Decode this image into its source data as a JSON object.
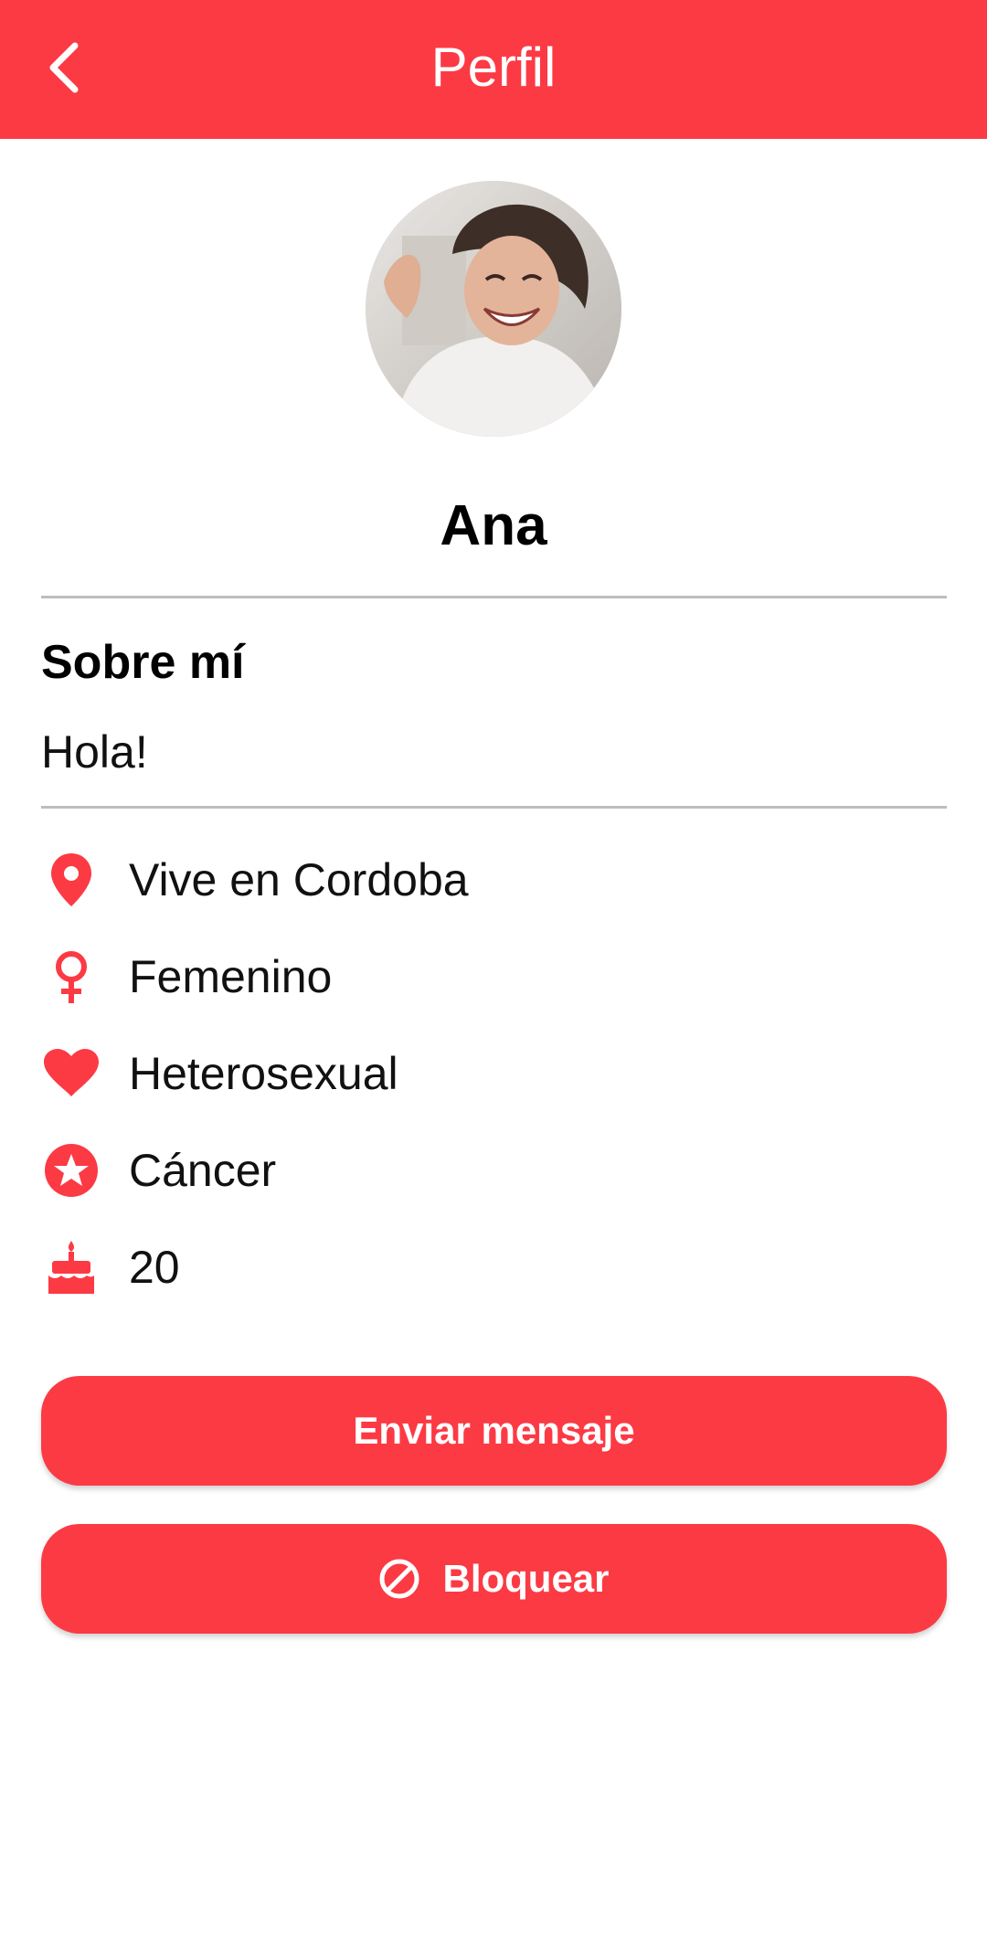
{
  "header": {
    "title": "Perfil",
    "back_icon": "chevron-left-icon",
    "background": "#fc3a44"
  },
  "profile": {
    "name": "Ana",
    "avatar_icon": "profile-photo"
  },
  "about": {
    "title": "Sobre mí",
    "text": "Hola!"
  },
  "details": [
    {
      "icon": "location-pin-icon",
      "text": "Vive en Cordoba"
    },
    {
      "icon": "female-symbol-icon",
      "text": "Femenino"
    },
    {
      "icon": "heart-icon",
      "text": "Heterosexual"
    },
    {
      "icon": "star-circle-icon",
      "text": "Cáncer"
    },
    {
      "icon": "birthday-cake-icon",
      "text": "20"
    }
  ],
  "actions": {
    "send_message": "Enviar mensaje",
    "block": "Bloquear",
    "block_icon": "block-icon"
  },
  "colors": {
    "accent": "#fc3a44",
    "divider": "#bdbdbd"
  }
}
